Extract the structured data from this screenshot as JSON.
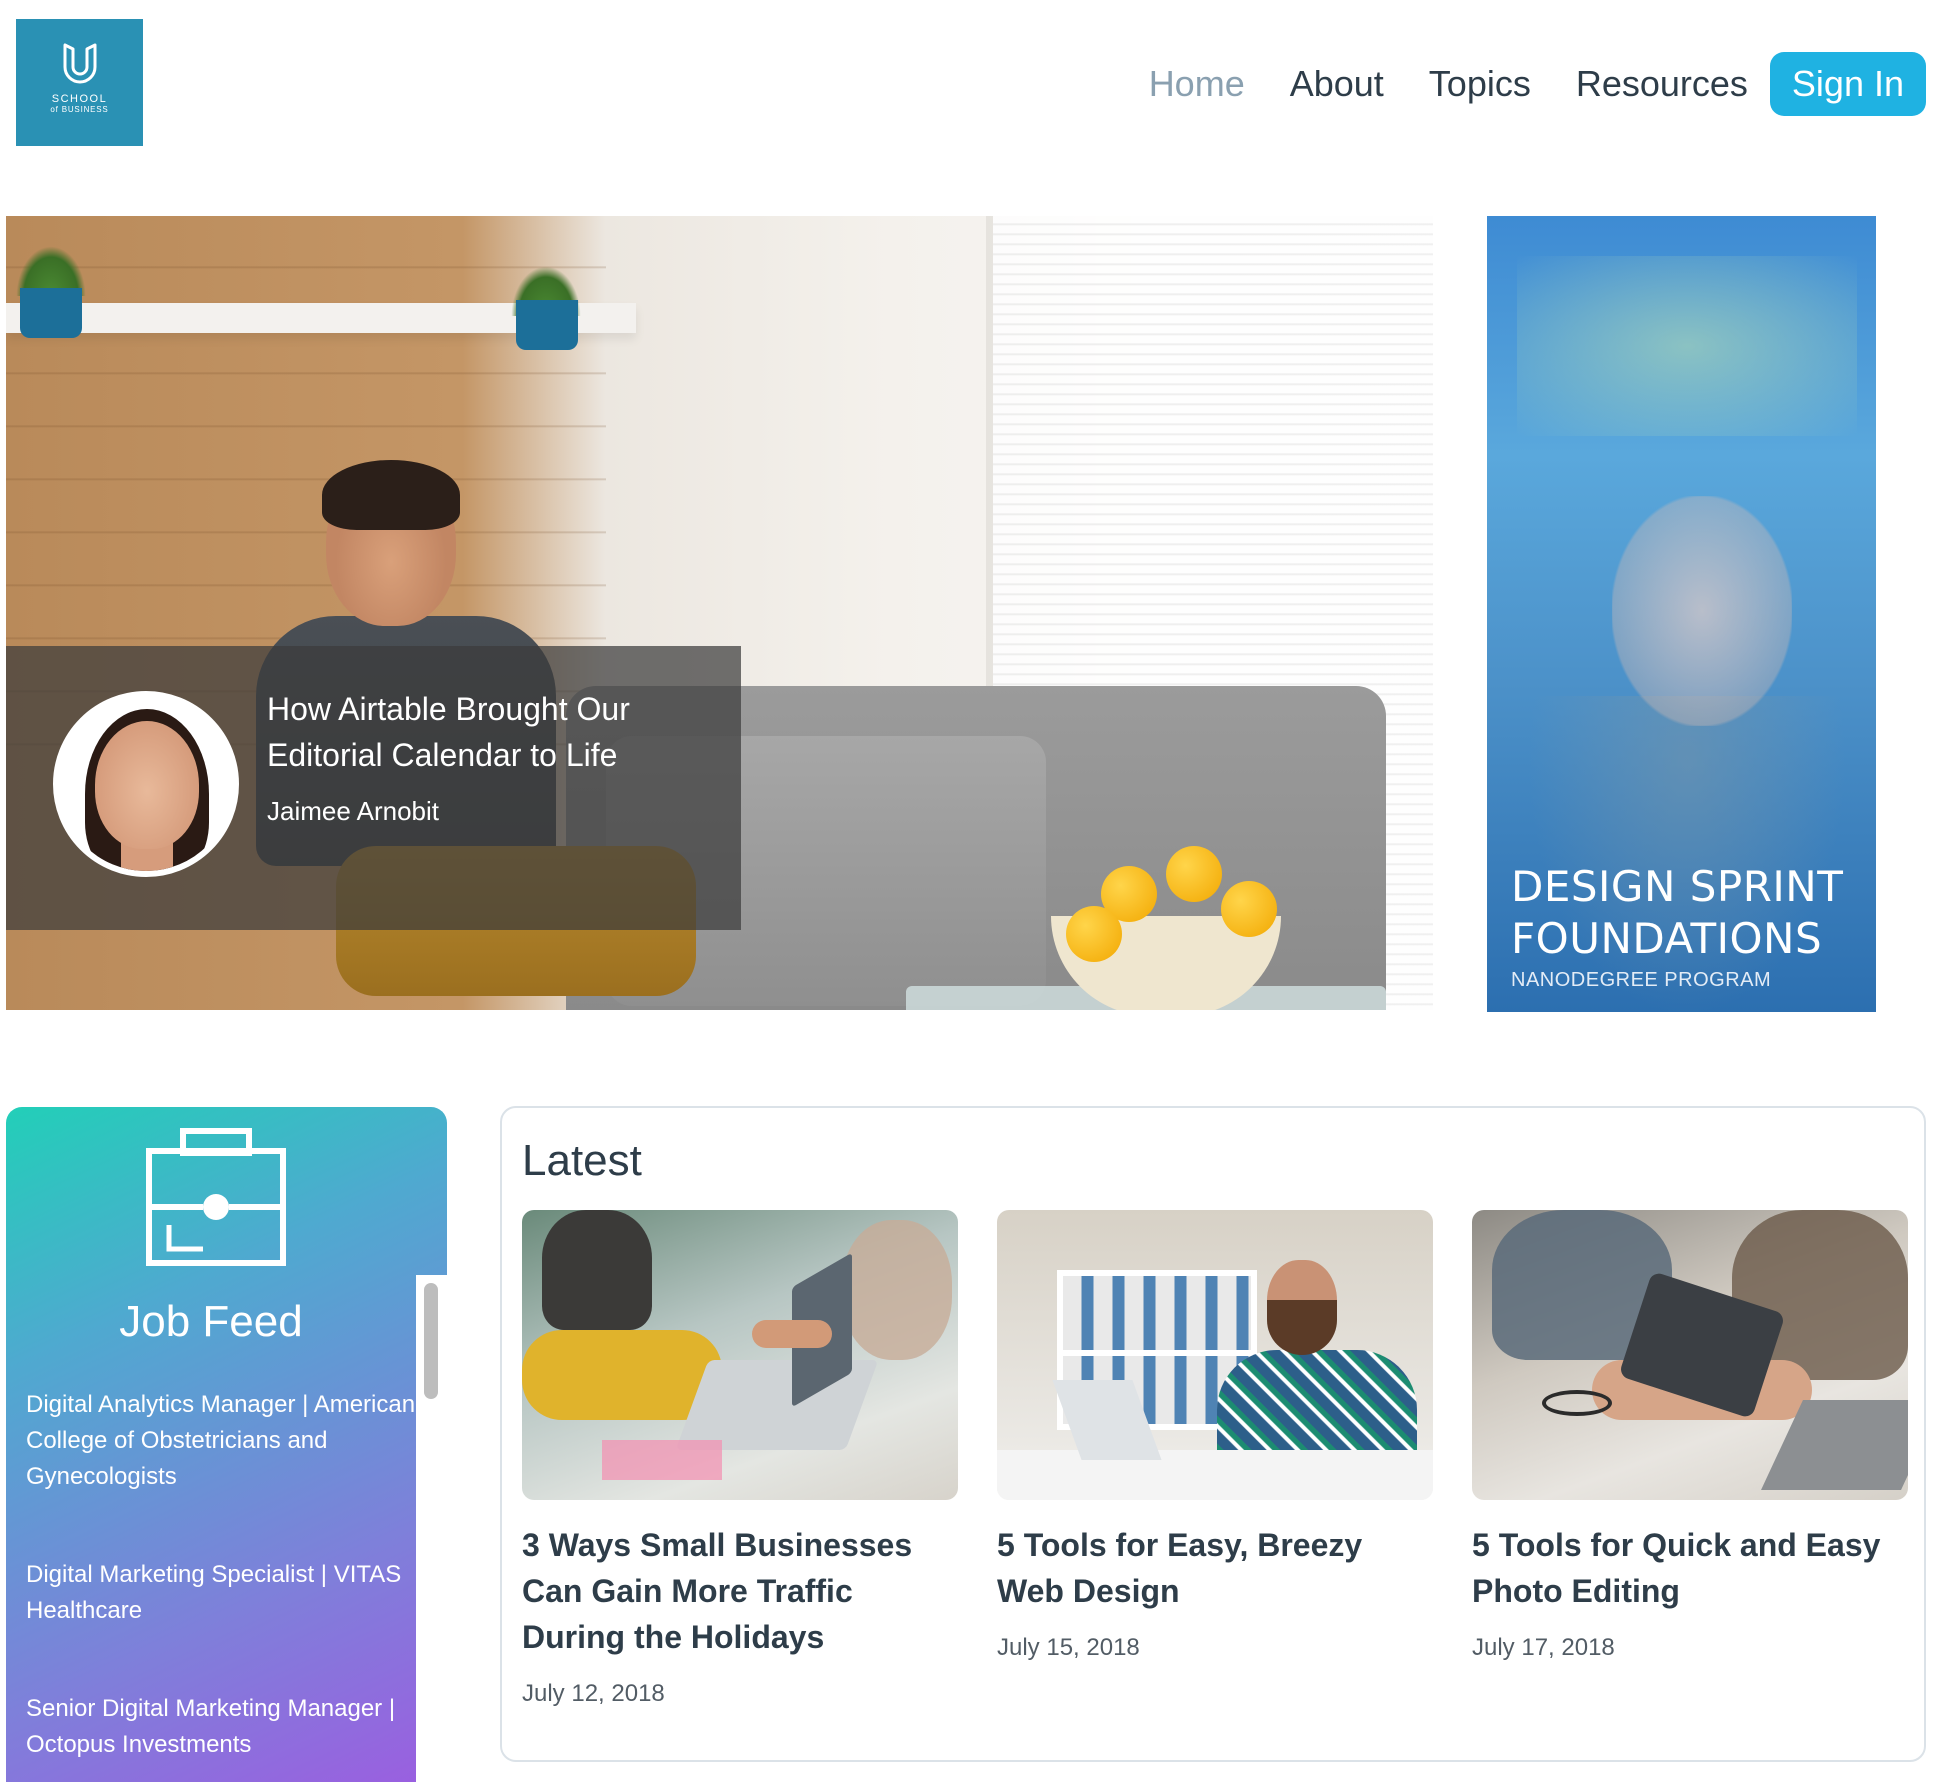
{
  "header": {
    "logo": {
      "line1": "SCHOOL",
      "line2": "of BUSINESS",
      "brand_color": "#2a91b4"
    },
    "nav": [
      {
        "label": "Home",
        "active": true
      },
      {
        "label": "About",
        "active": false
      },
      {
        "label": "Topics",
        "active": false
      },
      {
        "label": "Resources",
        "active": false
      }
    ],
    "signin_label": "Sign In",
    "signin_color": "#1fb2e2"
  },
  "hero": {
    "title": "How Airtable Brought Our Editorial Calendar to Life",
    "author": "Jaimee Arnobit"
  },
  "promo": {
    "title_line1": "DESIGN SPRINT",
    "title_line2": "FOUNDATIONS",
    "subtitle": "NANODEGREE PROGRAM"
  },
  "jobfeed": {
    "title": "Job Feed",
    "icon": "briefcase-icon",
    "jobs": [
      "Digital Analytics Manager | American College of Obstetricians and Gynecologists",
      "Digital Marketing Specialist | VITAS Healthcare",
      "Senior Digital Marketing Manager | Octopus Investments"
    ]
  },
  "latest": {
    "title": "Latest",
    "cards": [
      {
        "title": "3 Ways Small Businesses Can Gain More Traffic During the Holidays",
        "date": "July 12, 2018"
      },
      {
        "title": "5 Tools for Easy, Breezy Web Design",
        "date": "July 15, 2018"
      },
      {
        "title": "5 Tools for Quick and Easy Photo Editing",
        "date": "July 17, 2018"
      }
    ]
  }
}
